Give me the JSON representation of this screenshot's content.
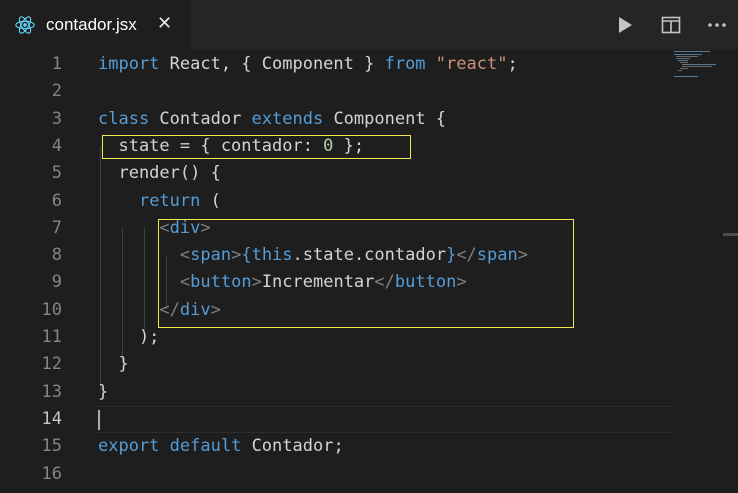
{
  "tab": {
    "filename": "contador.jsx",
    "close_glyph": "✕",
    "icon": "react-icon",
    "icon_color": "#61dafb"
  },
  "actions": [
    {
      "name": "run-icon",
      "label": "Run"
    },
    {
      "name": "split-editor-icon",
      "label": "Split Editor"
    },
    {
      "name": "more-actions-icon",
      "label": "More Actions"
    }
  ],
  "editor": {
    "active_line": 14,
    "lines": [
      {
        "num": "1",
        "parts": [
          [
            "k",
            "import"
          ],
          [
            "g",
            " React, { Component } "
          ],
          [
            "k",
            "from"
          ],
          [
            "g",
            " "
          ],
          [
            "s",
            "\"react\""
          ],
          [
            "g",
            ";"
          ]
        ]
      },
      {
        "num": "2",
        "parts": []
      },
      {
        "num": "3",
        "parts": [
          [
            "k",
            "class"
          ],
          [
            "g",
            " Contador "
          ],
          [
            "k",
            "extends"
          ],
          [
            "g",
            " Component {"
          ]
        ]
      },
      {
        "num": "4",
        "parts": [
          [
            "g",
            "  state = { contador: "
          ],
          [
            "n",
            "0"
          ],
          [
            "g",
            " };"
          ]
        ]
      },
      {
        "num": "5",
        "parts": [
          [
            "g",
            "  render() {"
          ]
        ]
      },
      {
        "num": "6",
        "parts": [
          [
            "g",
            "    "
          ],
          [
            "k",
            "return"
          ],
          [
            "g",
            " ("
          ]
        ]
      },
      {
        "num": "7",
        "parts": [
          [
            "g",
            "      "
          ],
          [
            "p",
            "<"
          ],
          [
            "t",
            "div"
          ],
          [
            "p",
            ">"
          ]
        ]
      },
      {
        "num": "8",
        "parts": [
          [
            "g",
            "        "
          ],
          [
            "p",
            "<"
          ],
          [
            "t",
            "span"
          ],
          [
            "p",
            ">"
          ],
          [
            "k",
            "{this"
          ],
          [
            "g",
            ".state.contador"
          ],
          [
            "k",
            "}"
          ],
          [
            "p",
            "</"
          ],
          [
            "t",
            "span"
          ],
          [
            "p",
            ">"
          ]
        ]
      },
      {
        "num": "9",
        "parts": [
          [
            "g",
            "        "
          ],
          [
            "p",
            "<"
          ],
          [
            "t",
            "button"
          ],
          [
            "p",
            ">"
          ],
          [
            "g",
            "Incrementar"
          ],
          [
            "p",
            "</"
          ],
          [
            "t",
            "button"
          ],
          [
            "p",
            ">"
          ]
        ]
      },
      {
        "num": "10",
        "parts": [
          [
            "g",
            "      "
          ],
          [
            "p",
            "</"
          ],
          [
            "t",
            "div"
          ],
          [
            "p",
            ">"
          ]
        ]
      },
      {
        "num": "11",
        "parts": [
          [
            "g",
            "    );"
          ]
        ]
      },
      {
        "num": "12",
        "parts": [
          [
            "g",
            "  }"
          ]
        ]
      },
      {
        "num": "13",
        "parts": [
          [
            "g",
            "}"
          ]
        ]
      },
      {
        "num": "14",
        "parts": []
      },
      {
        "num": "15",
        "parts": [
          [
            "k",
            "export"
          ],
          [
            "g",
            " "
          ],
          [
            "k",
            "default"
          ],
          [
            "g",
            " Contador;"
          ]
        ]
      },
      {
        "num": "16",
        "parts": []
      }
    ]
  },
  "colors": {
    "keyword": "#569cd6",
    "string": "#ce9178",
    "number": "#b5cea8",
    "highlight_box": "#f2e94e"
  }
}
